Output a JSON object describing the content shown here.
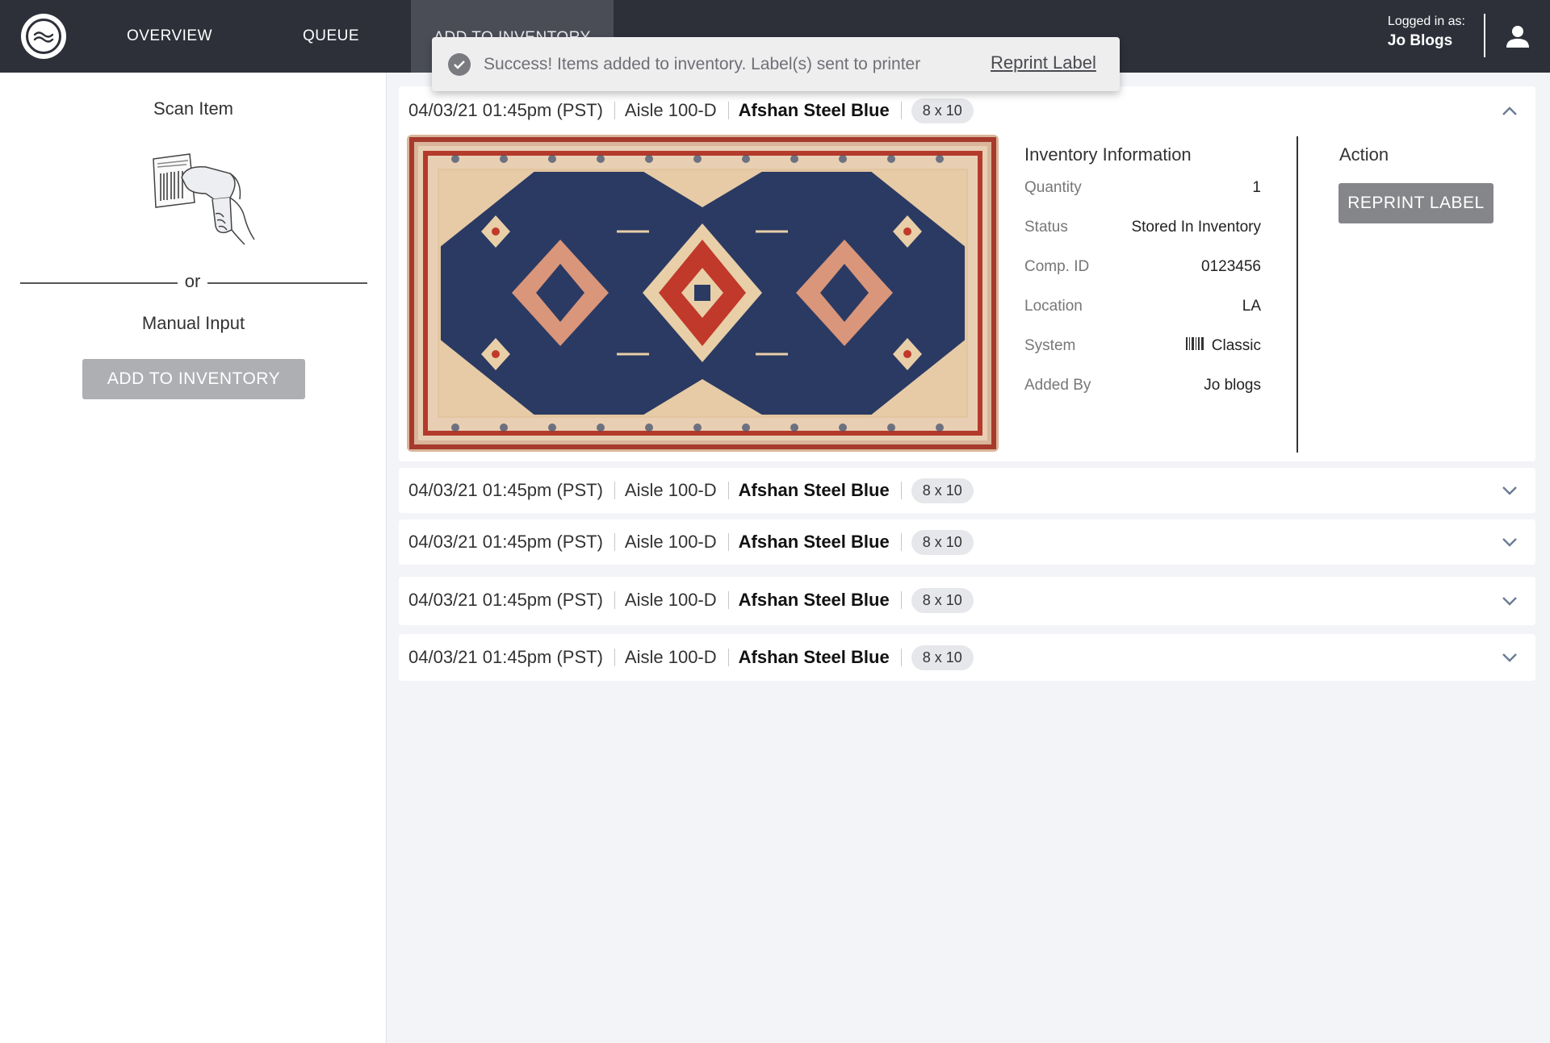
{
  "nav": {
    "tabs": [
      {
        "label": "OVERVIEW"
      },
      {
        "label": "QUEUE"
      },
      {
        "label": "ADD TO INVENTORY"
      }
    ],
    "logged_in_label": "Logged in as:",
    "user_name": "Jo Blogs"
  },
  "toast": {
    "message": "Success! Items added to inventory. Label(s) sent to printer",
    "link": "Reprint Label"
  },
  "left": {
    "scan_title": "Scan Item",
    "or": "or",
    "manual_title": "Manual Input",
    "add_button": "ADD TO INVENTORY"
  },
  "items": [
    {
      "datetime": "04/03/21 01:45pm (PST)",
      "aisle": "Aisle 100-D",
      "name": "Afshan Steel Blue",
      "size": "8 x 10",
      "expanded": true
    },
    {
      "datetime": "04/03/21 01:45pm (PST)",
      "aisle": "Aisle 100-D",
      "name": "Afshan Steel Blue",
      "size": "8 x 10",
      "expanded": false
    },
    {
      "datetime": "04/03/21 01:45pm (PST)",
      "aisle": "Aisle 100-D",
      "name": "Afshan Steel Blue",
      "size": "8 x 10",
      "expanded": false
    },
    {
      "datetime": "04/03/21 01:45pm (PST)",
      "aisle": "Aisle 100-D",
      "name": "Afshan Steel Blue",
      "size": "8 x 10",
      "expanded": false
    },
    {
      "datetime": "04/03/21 01:45pm (PST)",
      "aisle": "Aisle 100-D",
      "name": "Afshan Steel Blue",
      "size": "8 x 10",
      "expanded": false
    }
  ],
  "detail": {
    "inventory_title": "Inventory Information",
    "fields": [
      {
        "label": "Quantity",
        "value": "1"
      },
      {
        "label": "Status",
        "value": "Stored In Inventory"
      },
      {
        "label": "Comp. ID",
        "value": "0123456"
      },
      {
        "label": "Location",
        "value": "LA"
      },
      {
        "label": "System",
        "value": "Classic",
        "icon": "barcode-icon"
      },
      {
        "label": "Added By",
        "value": "Jo blogs"
      }
    ],
    "action_title": "Action",
    "reprint_button": "REPRINT LABEL"
  }
}
